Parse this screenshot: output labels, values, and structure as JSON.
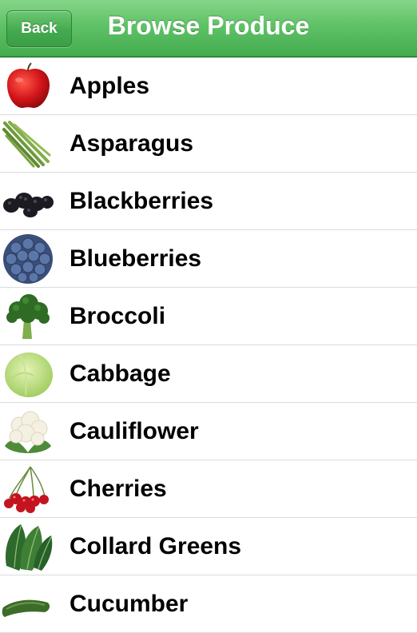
{
  "navbar": {
    "back_label": "Back",
    "title": "Browse Produce"
  },
  "produce": [
    {
      "name": "Apples",
      "icon": "apple-icon"
    },
    {
      "name": "Asparagus",
      "icon": "asparagus-icon"
    },
    {
      "name": "Blackberries",
      "icon": "blackberries-icon"
    },
    {
      "name": "Blueberries",
      "icon": "blueberries-icon"
    },
    {
      "name": "Broccoli",
      "icon": "broccoli-icon"
    },
    {
      "name": "Cabbage",
      "icon": "cabbage-icon"
    },
    {
      "name": "Cauliflower",
      "icon": "cauliflower-icon"
    },
    {
      "name": "Cherries",
      "icon": "cherries-icon"
    },
    {
      "name": "Collard Greens",
      "icon": "collard-greens-icon"
    },
    {
      "name": "Cucumber",
      "icon": "cucumber-icon"
    }
  ],
  "colors": {
    "navbar_green": "#5fc266",
    "navbar_border": "#2f8a3a",
    "separator": "#dcdcdc",
    "text": "#000000"
  }
}
